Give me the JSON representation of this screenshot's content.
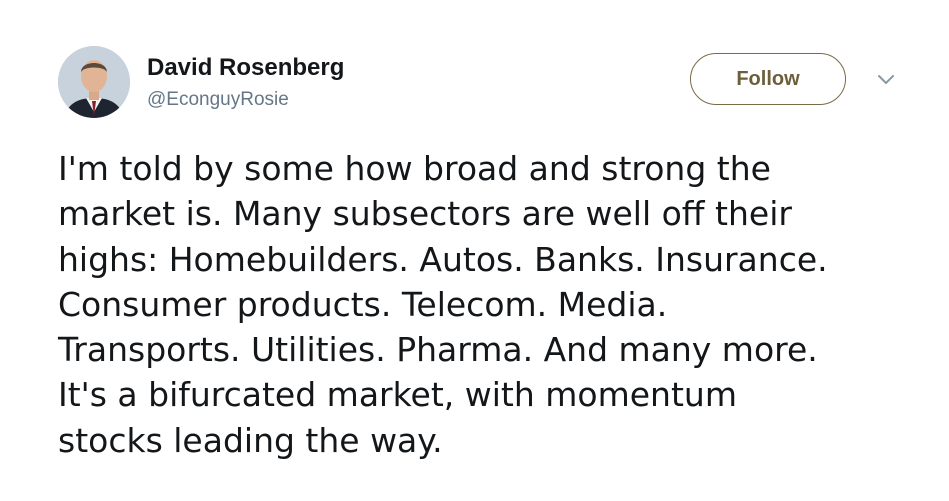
{
  "author": {
    "display_name": "David Rosenberg",
    "handle": "@EconguyRosie"
  },
  "actions": {
    "follow_label": "Follow"
  },
  "icons": {
    "avatar": "profile-photo",
    "caret": "chevron-down-icon"
  },
  "colors": {
    "follow_border": "#7a6a45",
    "follow_text": "#6e5f3c",
    "handle": "#657786",
    "text": "#14171a"
  },
  "tweet": {
    "lines": [
      "I'm told by some how broad and strong the",
      "market is. Many subsectors are well off their",
      "highs: Homebuilders. Autos. Banks. Insurance.",
      "Consumer products. Telecom. Media.",
      "Transports. Utilities. Pharma. And many more.",
      "It's a bifurcated market, with momentum",
      "stocks leading the way."
    ]
  }
}
